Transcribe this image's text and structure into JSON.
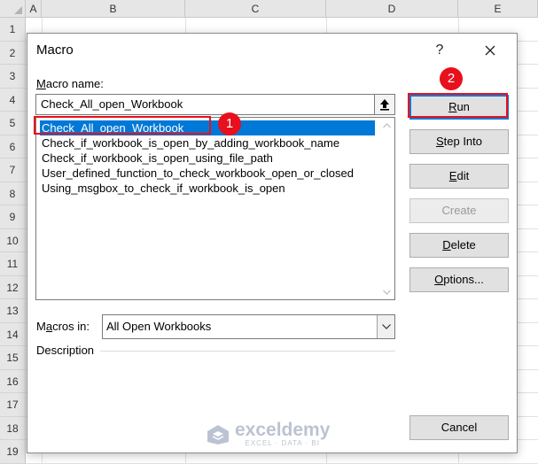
{
  "sheet": {
    "columns": [
      "A",
      "B",
      "C",
      "D",
      "E"
    ],
    "rows": [
      "1",
      "2",
      "3",
      "4",
      "5",
      "6",
      "7",
      "8",
      "9",
      "10",
      "11",
      "12",
      "13",
      "14",
      "15",
      "16",
      "17",
      "18",
      "19"
    ]
  },
  "dialog": {
    "title": "Macro",
    "help_label": "?",
    "close_label": "✕",
    "macro_name_label": "Macro name:",
    "macro_name_value": "Check_All_open_Workbook",
    "macros": [
      "Check_All_open_Workbook",
      "Check_if_workbook_is_open_by_adding_workbook_name",
      "Check_if_workbook_is_open_using_file_path",
      "User_defined_function_to_check_workbook_open_or_closed",
      "Using_msgbox_to_check_if_workbook_is_open"
    ],
    "selected_index": 0,
    "macros_in_label": "Macros in:",
    "macros_in_value": "All Open Workbooks",
    "description_label": "Description",
    "buttons": {
      "run": "Run",
      "step_into": "Step Into",
      "edit": "Edit",
      "create": "Create",
      "delete": "Delete",
      "options": "Options...",
      "cancel": "Cancel"
    }
  },
  "annotations": {
    "step1": "1",
    "step2": "2",
    "color": "#e8101c"
  },
  "watermark": {
    "name": "exceldemy",
    "tagline": "EXCEL · DATA · BI"
  },
  "colors": {
    "selection": "#0078d7",
    "grid_header": "#e6e6e6"
  }
}
